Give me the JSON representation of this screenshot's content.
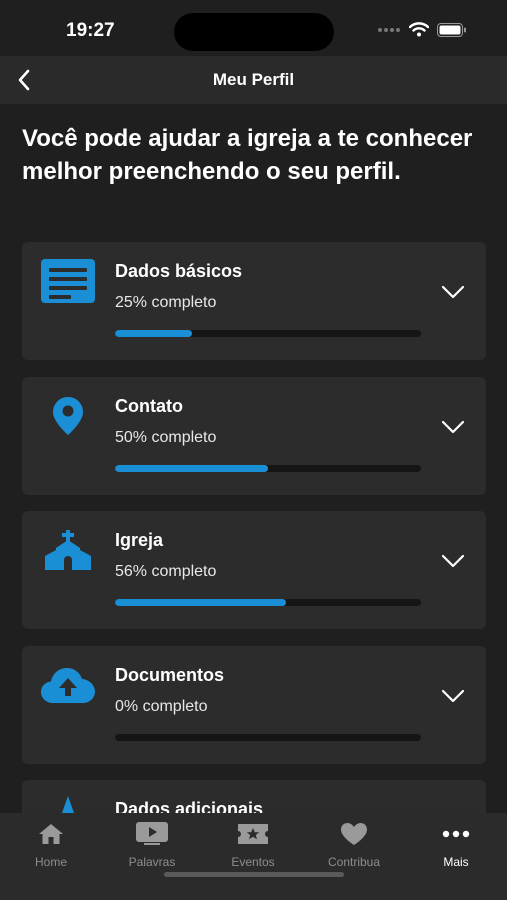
{
  "status": {
    "time": "19:27"
  },
  "nav": {
    "title": "Meu Perfil"
  },
  "intro": "Você pode ajudar a igreja a te conhecer melhor preenchendo o seu perfil.",
  "colors": {
    "accent": "#1a8fd6",
    "card": "#2c2c2c",
    "background": "#1f1f1f"
  },
  "sections": [
    {
      "title": "Dados básicos",
      "subtitle": "25% completo",
      "progress": 0.25,
      "icon": "document-lines-icon"
    },
    {
      "title": "Contato",
      "subtitle": "50% completo",
      "progress": 0.5,
      "icon": "location-pin-icon"
    },
    {
      "title": "Igreja",
      "subtitle": "56% completo",
      "progress": 0.56,
      "icon": "church-icon"
    },
    {
      "title": "Documentos",
      "subtitle": "0% completo",
      "progress": 0.0,
      "icon": "cloud-upload-icon"
    },
    {
      "title": "Dados adicionais",
      "icon": "star-icon"
    }
  ],
  "tabs": [
    {
      "label": "Home",
      "icon": "home-icon",
      "active": false
    },
    {
      "label": "Palavras",
      "icon": "video-icon",
      "active": false
    },
    {
      "label": "Eventos",
      "icon": "ticket-icon",
      "active": false
    },
    {
      "label": "Contribua",
      "icon": "heart-icon",
      "active": false
    },
    {
      "label": "Mais",
      "icon": "more-dots-icon",
      "active": true
    }
  ]
}
